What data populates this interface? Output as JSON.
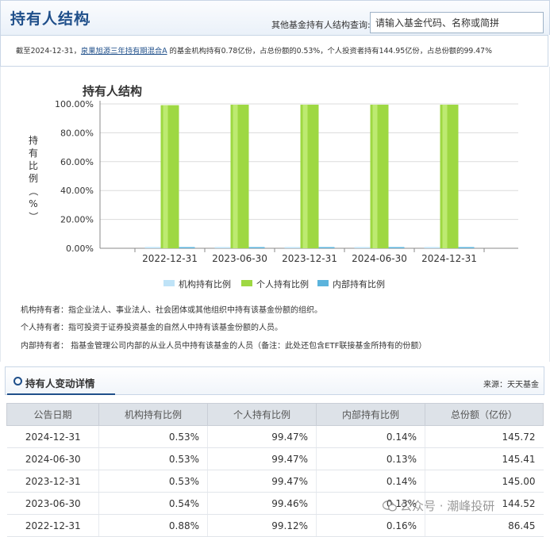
{
  "header": {
    "title": "持有人结构",
    "search_label": "其他基金持有人结构查询:",
    "search_placeholder": "请输入基金代码、名称或简拼"
  },
  "summary": {
    "prefix": "截至2024-12-31，",
    "fund_link": "泉果旭源三年持有期混合A",
    "suffix": " 的基金机构持有0.78亿份，占总份额的0.53%，个人投资者持有144.95亿份，占总份额的99.47%"
  },
  "chart_data": {
    "type": "bar",
    "title": "持有人结构",
    "ylabel": "持有比例（%）",
    "categories": [
      "2022-12-31",
      "2023-06-30",
      "2023-12-31",
      "2024-06-30",
      "2024-12-31"
    ],
    "series": [
      {
        "name": "机构持有比例",
        "color": "#bfe3f7",
        "values": [
          0.88,
          0.54,
          0.53,
          0.53,
          0.53
        ]
      },
      {
        "name": "个人持有比例",
        "color": "#9ed842",
        "values": [
          99.12,
          99.46,
          99.47,
          99.47,
          99.47
        ]
      },
      {
        "name": "内部持有比例",
        "color": "#5bb3dc",
        "values": [
          0.16,
          0.13,
          0.14,
          0.13,
          0.14
        ]
      }
    ],
    "ylim": [
      0,
      100
    ],
    "yticks": [
      "0.00%",
      "20.00%",
      "40.00%",
      "60.00%",
      "80.00%",
      "100.00%"
    ],
    "grid": true,
    "legend_position": "bottom"
  },
  "definitions": [
    "机构持有者：指企业法人、事业法人、社会团体或其他组织中持有该基金份额的组织。",
    "个人持有者：指可投资于证券投资基金的自然人中持有该基金份额的人员。",
    "内部持有者： 指基金管理公司内部的从业人员中持有该基金的人员（备注：此处还包含ETF联接基金所持有的份额）"
  ],
  "details": {
    "title": "持有人变动详情",
    "source": "来源：天天基金"
  },
  "table": {
    "headers": [
      "公告日期",
      "机构持有比例",
      "个人持有比例",
      "内部持有比例",
      "总份额（亿份）"
    ],
    "rows": [
      [
        "2024-12-31",
        "0.53%",
        "99.47%",
        "0.14%",
        "145.72"
      ],
      [
        "2024-06-30",
        "0.53%",
        "99.47%",
        "0.13%",
        "145.41"
      ],
      [
        "2023-12-31",
        "0.53%",
        "99.47%",
        "0.14%",
        "145.00"
      ],
      [
        "2023-06-30",
        "0.54%",
        "99.46%",
        "0.13%",
        "144.52"
      ],
      [
        "2022-12-31",
        "0.88%",
        "99.12%",
        "0.16%",
        "86.45"
      ]
    ]
  },
  "watermark": "公众号 · 潮峰投研"
}
